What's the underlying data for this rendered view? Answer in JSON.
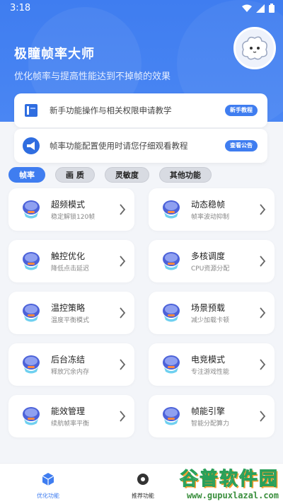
{
  "status_bar": {
    "time": "3:18"
  },
  "header": {
    "title": "极瞳帧率大师",
    "subtitle": "优化帧率与提高性能达到不掉帧的效果"
  },
  "notices": [
    {
      "text": "新手功能操作与相关权限申请教学",
      "button": "新手教程",
      "icon": "book-icon"
    },
    {
      "text": "帧率功能配置使用时请您仔细观看教程",
      "button": "查看公告",
      "icon": "megaphone-icon"
    }
  ],
  "tabs": [
    {
      "label": "帧率",
      "active": true
    },
    {
      "label": "画 质",
      "active": false
    },
    {
      "label": "灵敏度",
      "active": false
    },
    {
      "label": "其他功能",
      "active": false
    }
  ],
  "cards": [
    {
      "title": "超频模式",
      "subtitle": "稳定解锁120帧"
    },
    {
      "title": "动态稳帧",
      "subtitle": "帧率波动抑制"
    },
    {
      "title": "触控优化",
      "subtitle": "降低点击延迟"
    },
    {
      "title": "多核调度",
      "subtitle": "CPU资源分配"
    },
    {
      "title": "温控策略",
      "subtitle": "温度平衡模式"
    },
    {
      "title": "场景预载",
      "subtitle": "减少加载卡顿"
    },
    {
      "title": "后台冻结",
      "subtitle": "释放冗余内存"
    },
    {
      "title": "电竞模式",
      "subtitle": "专注游戏性能"
    },
    {
      "title": "能效管理",
      "subtitle": "续航帧率平衡"
    },
    {
      "title": "帧能引擎",
      "subtitle": "智能分配算力"
    }
  ],
  "bottom_nav": [
    {
      "label": "优化功能",
      "icon": "cube-icon",
      "active": true
    },
    {
      "label": "推荐功能",
      "icon": "gear-icon",
      "active": false
    }
  ],
  "watermark": {
    "brand": "谷普软件园",
    "url": "www.gupuxlazal.com"
  },
  "colors": {
    "accent": "#3f7df0",
    "background": "#f3f5f9"
  }
}
